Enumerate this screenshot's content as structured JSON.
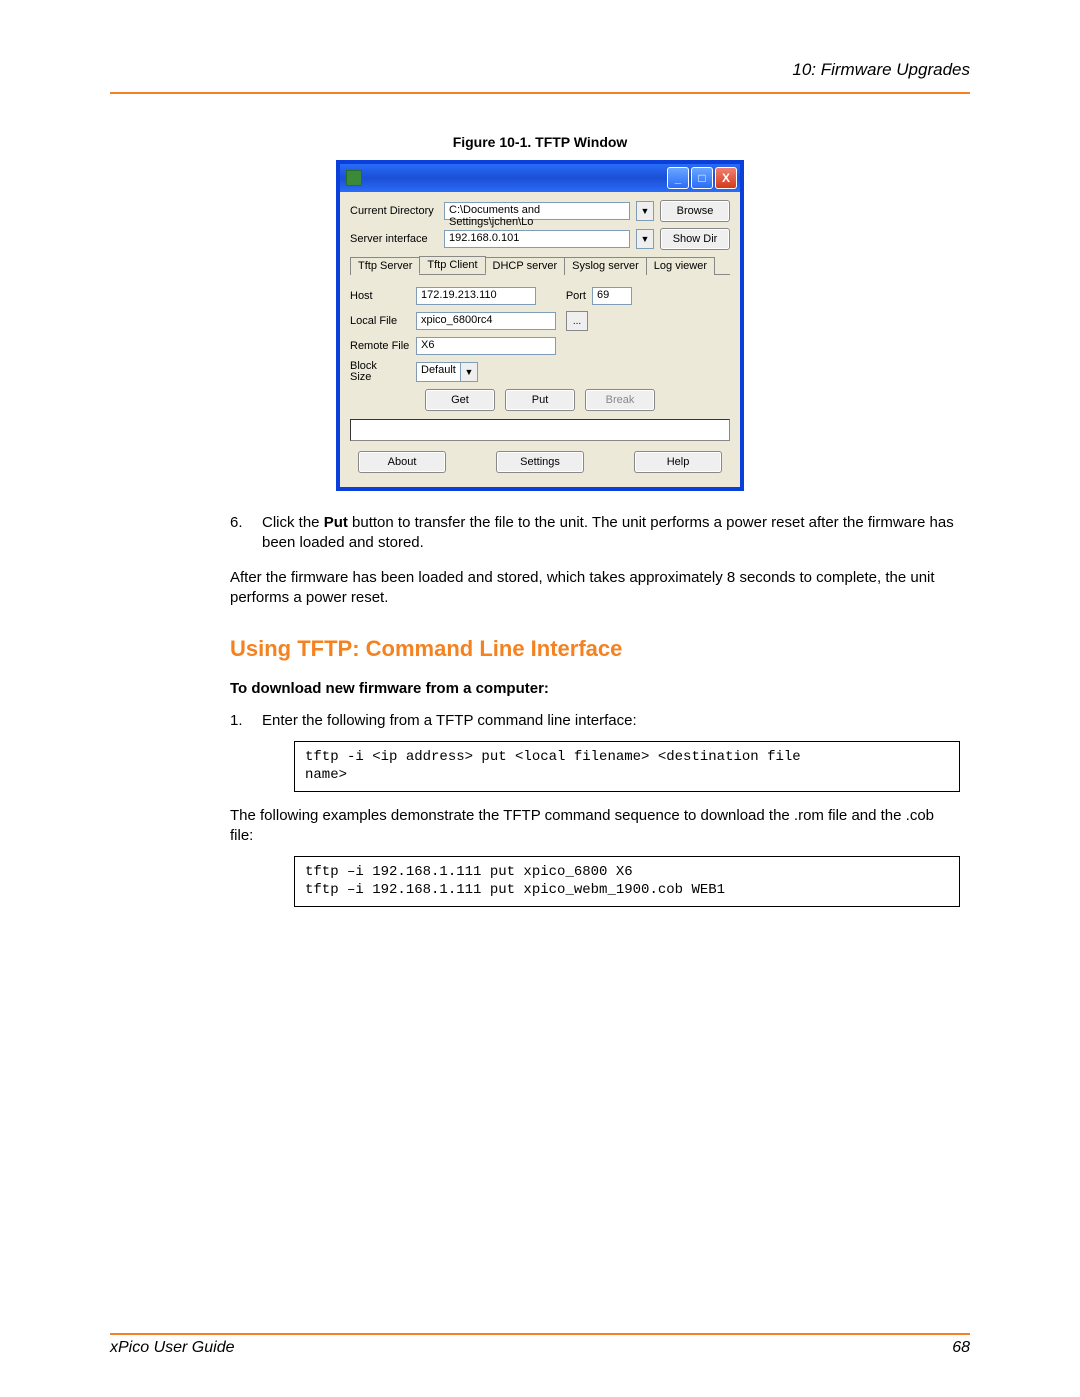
{
  "header": {
    "chapter": "10: Firmware Upgrades"
  },
  "figure": {
    "caption": "Figure 10-1. TFTP Window"
  },
  "tftp": {
    "labels": {
      "current_dir": "Current Directory",
      "server_if": "Server interface",
      "host": "Host",
      "port": "Port",
      "local_file": "Local File",
      "remote_file": "Remote File",
      "block_size": "Block\nSize"
    },
    "values": {
      "current_dir": "C:\\Documents and Settings\\jchen\\Lo",
      "server_if": "192.168.0.101",
      "host": "172.19.213.110",
      "port": "69",
      "local_file": "xpico_6800rc4",
      "remote_file": "X6",
      "block_size": "Default"
    },
    "buttons": {
      "browse": "Browse",
      "show_dir": "Show Dir",
      "dots": "...",
      "get": "Get",
      "put": "Put",
      "break": "Break",
      "about": "About",
      "settings": "Settings",
      "help": "Help"
    },
    "tabs": {
      "tftp_server": "Tftp Server",
      "tftp_client": "Tftp Client",
      "dhcp_server": "DHCP server",
      "syslog_server": "Syslog server",
      "log_viewer": "Log viewer"
    },
    "winbtns": {
      "min": "_",
      "max": "□",
      "close": "X"
    }
  },
  "steps": {
    "six_num": "6.",
    "six_a": "Click the ",
    "six_bold": "Put",
    "six_b": " button to transfer the file to the unit. The unit performs a power reset after the firmware has been loaded and stored."
  },
  "para_after": "After the firmware has been loaded and stored, which takes approximately 8 seconds to complete, the unit performs a power reset.",
  "h2": "Using TFTP: Command Line Interface",
  "subhead": "To download new firmware from a computer:",
  "step1_num": "1.",
  "step1_text": "Enter the following from a TFTP command line interface:",
  "code1": "tftp -i <ip address> put <local filename> <destination file\nname>",
  "para2": "The following examples demonstrate the TFTP command sequence to download the .rom file and the .cob file:",
  "code2": "tftp –i 192.168.1.111 put xpico_6800 X6\ntftp –i 192.168.1.111 put xpico_webm_1900.cob WEB1",
  "footer": {
    "guide": "xPico User Guide",
    "page": "68"
  }
}
